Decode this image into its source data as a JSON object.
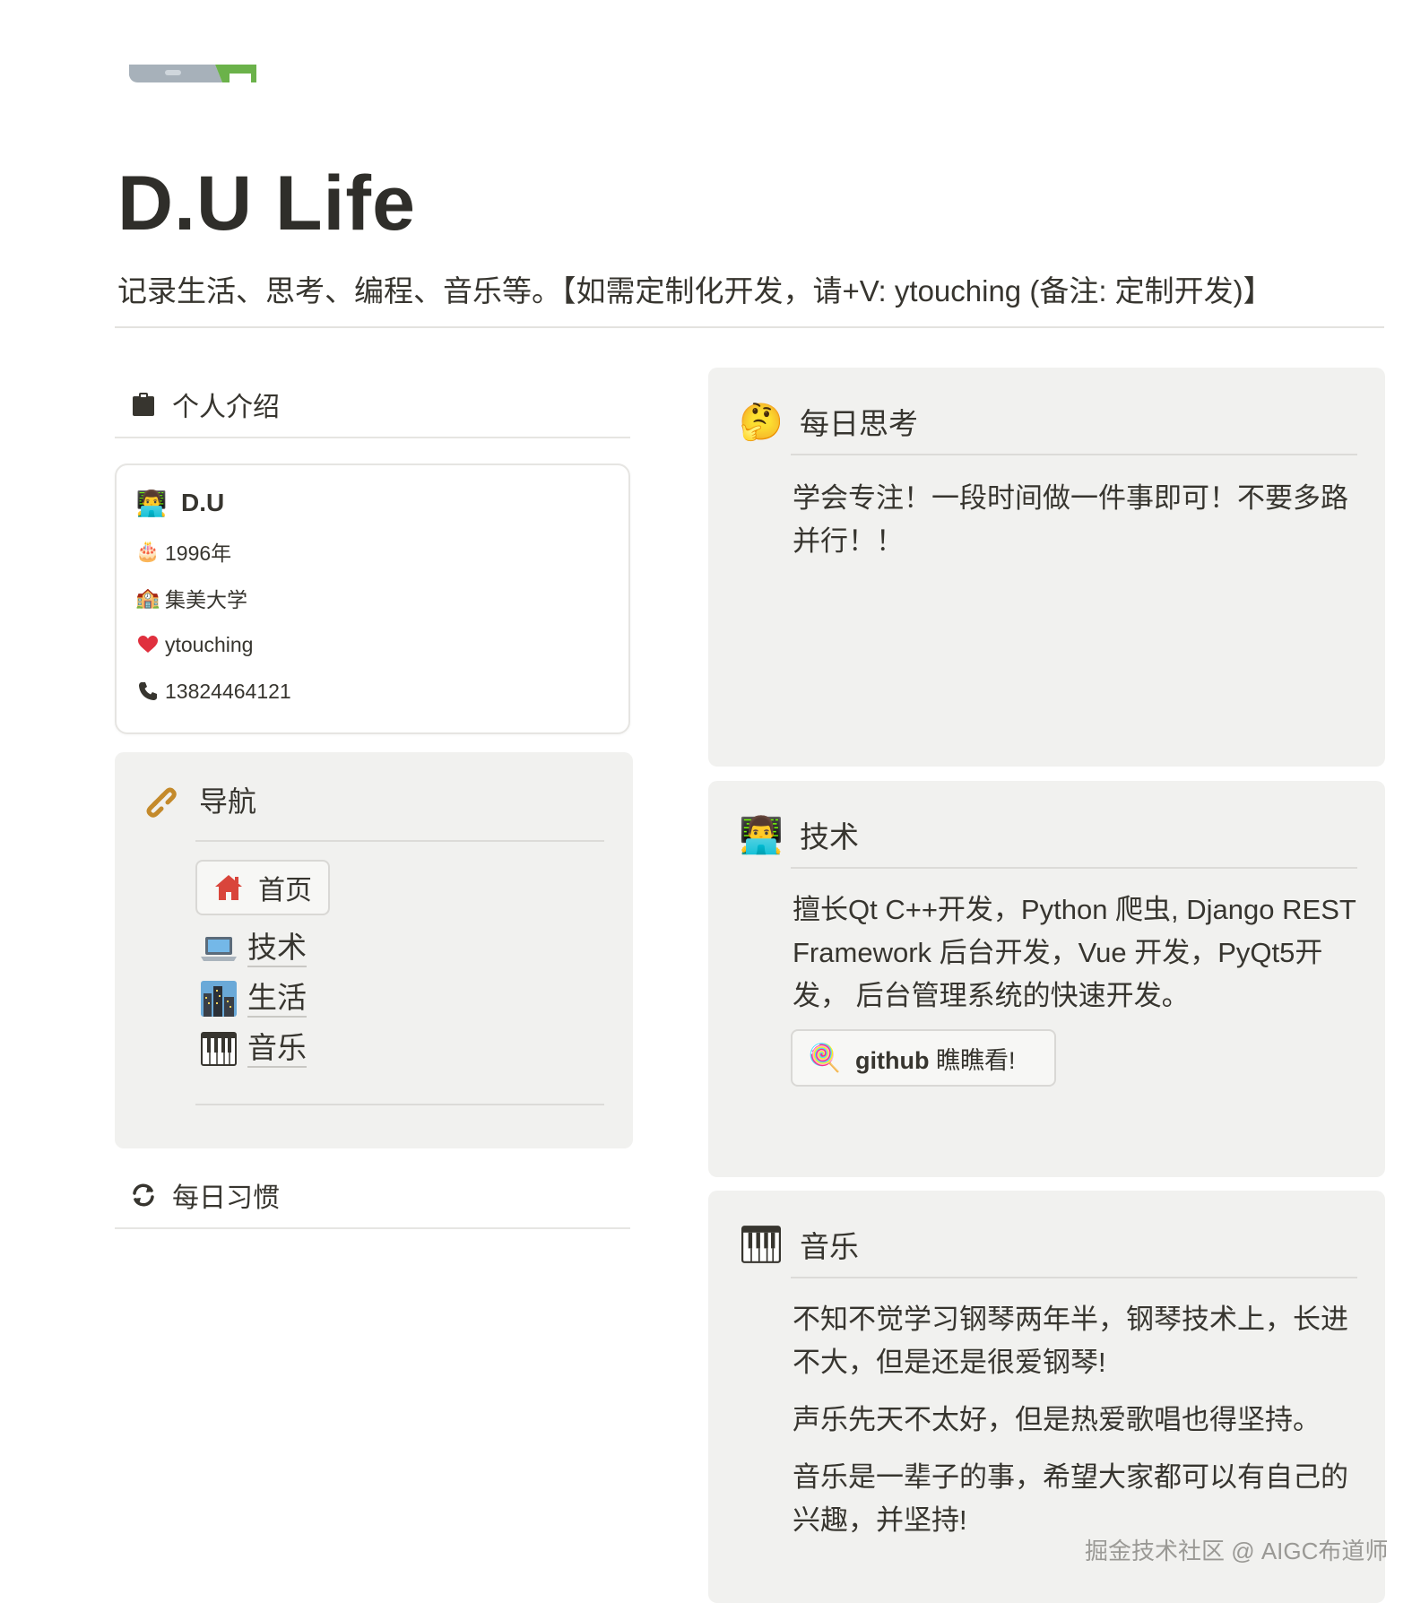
{
  "page": {
    "title": "D.U  Life",
    "subtitle": "记录生活、思考、编程、音乐等。【如需定制化开发，请+V:  ytouching  (备注: 定制开发)】"
  },
  "left": {
    "intro_heading": "个人介绍",
    "profile": {
      "name": "D.U",
      "birth": "1996年",
      "school": "集美大学",
      "wechat": "ytouching",
      "phone": "13824464121"
    },
    "nav": {
      "heading": "导航",
      "home": "首页",
      "items": [
        "技术",
        "生活",
        "音乐"
      ]
    },
    "habit_heading": "每日习惯"
  },
  "right": {
    "thinking": {
      "heading": "每日思考",
      "text": "学会专注！一段时间做一件事即可！不要多路并行！！"
    },
    "tech": {
      "heading": "技术",
      "text": "擅长Qt C++开发，Python 爬虫, Django REST Framework 后台开发，Vue 开发，PyQt5开发， 后台管理系统的快速开发。",
      "github_strong": "github",
      "github_rest": " 瞧瞧看!"
    },
    "music": {
      "heading": "音乐",
      "paragraphs": [
        "不知不觉学习钢琴两年半，钢琴技术上，长进不大，但是还是很爱钢琴!",
        "声乐先天不太好，但是热爱歌唱也得坚持。",
        "音乐是一辈子的事，希望大家都可以有自己的兴趣，并坚持!"
      ]
    }
  },
  "watermark": "掘金技术社区 @ AIGC布道师",
  "icons": {
    "cover": "notion-cover-icon",
    "intro": "clipboard-icon",
    "profile_name": "technologist-icon",
    "birth": "cake-icon",
    "school": "school-icon",
    "wechat": "heart-icon",
    "phone": "phone-icon",
    "nav": "link-icon",
    "home": "house-icon",
    "tech": "laptop-icon",
    "life": "cityscape-icon",
    "music": "piano-icon",
    "habit": "refresh-icon",
    "thinking": "thinking-face-icon",
    "github": "lollipop-icon"
  },
  "colors": {
    "text": "#37352f",
    "card_bg": "#f1f1ef",
    "divider": "#e6e5e2",
    "house": "#d9453b",
    "heart": "#e0303e",
    "link": "#c48a2b"
  }
}
